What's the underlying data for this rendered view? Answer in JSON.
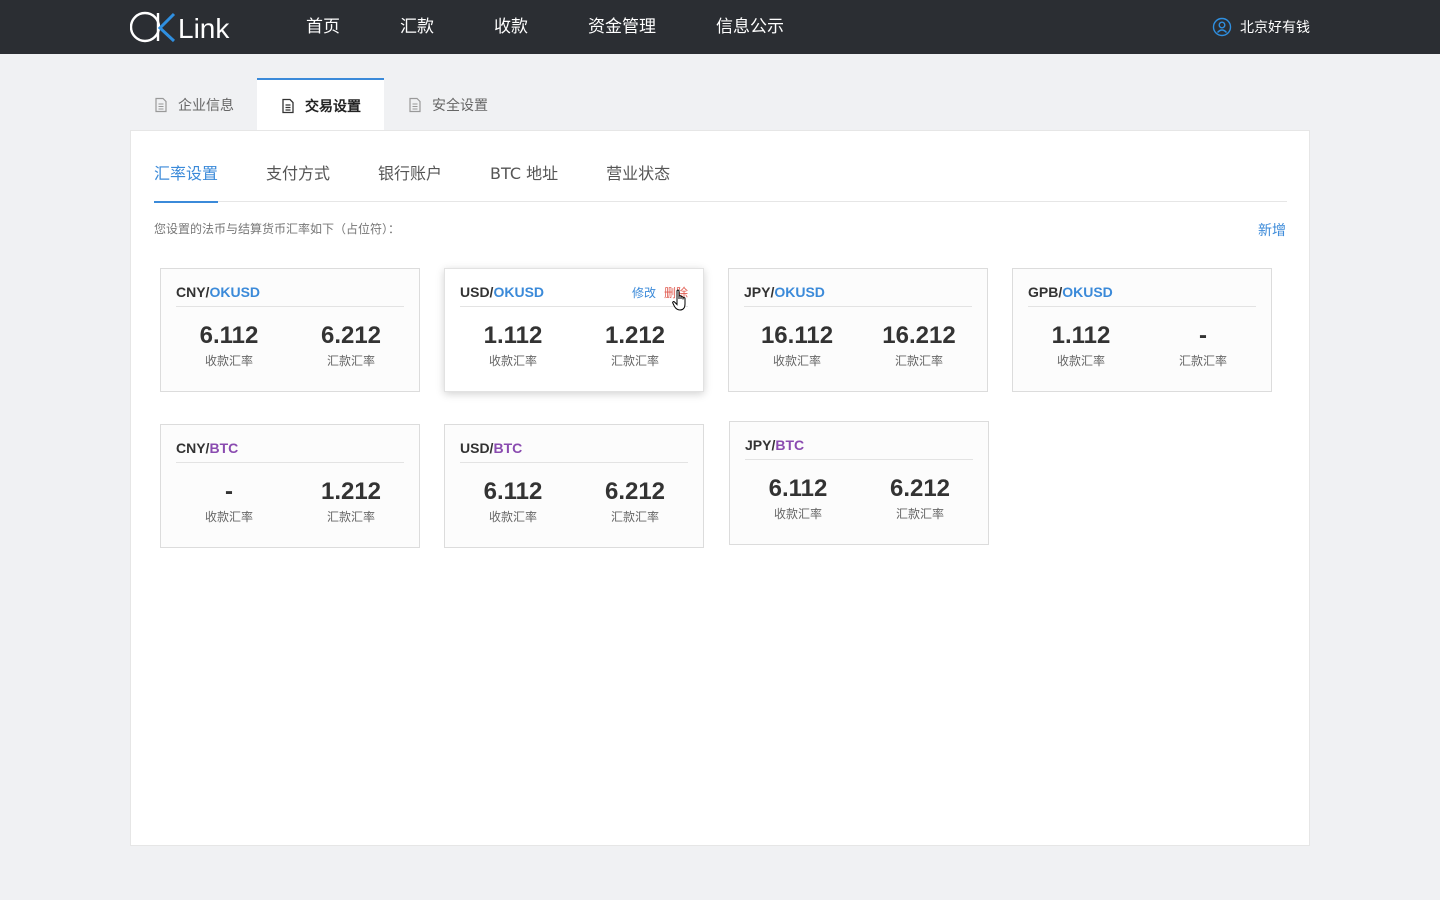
{
  "brand": {
    "logo_text": "OKLink",
    "colors": {
      "topbar": "#2b2e33",
      "accent": "#3b8ad9",
      "danger": "#e05a4f",
      "btc_purple": "#8a4bb0"
    }
  },
  "nav": {
    "items": [
      "首页",
      "汇款",
      "收款",
      "资金管理",
      "信息公示"
    ],
    "user_name": "北京好有钱",
    "user_icon": "user-icon"
  },
  "main_tabs": [
    {
      "label": "企业信息",
      "icon": "document-icon",
      "active": false
    },
    {
      "label": "交易设置",
      "icon": "document-icon",
      "active": true
    },
    {
      "label": "安全设置",
      "icon": "document-icon",
      "active": false
    }
  ],
  "sub_tabs": [
    {
      "label": "汇率设置",
      "active": true
    },
    {
      "label": "支付方式",
      "active": false
    },
    {
      "label": "银行账户",
      "active": false
    },
    {
      "label": "BTC 地址",
      "active": false
    },
    {
      "label": "营业状态",
      "active": false
    }
  ],
  "rates": {
    "description": "您设置的法币与结算货币汇率如下（占位符）：",
    "add_label": "新增",
    "receive_label": "收款汇率",
    "remit_label": "汇款汇率",
    "edit_label": "修改",
    "delete_label": "删除",
    "cards": [
      {
        "base": "CNY/",
        "quote": "OKUSD",
        "receive": "6.112",
        "remit": "6.212"
      },
      {
        "base": "USD/",
        "quote": "OKUSD",
        "receive": "1.112",
        "remit": "1.212"
      },
      {
        "base": "JPY/",
        "quote": "OKUSD",
        "receive": "16.112",
        "remit": "16.212"
      },
      {
        "base": "GPB/",
        "quote": "OKUSD",
        "receive": "1.112",
        "remit": "-"
      },
      {
        "base": "CNY/",
        "quote": "BTC",
        "receive": "-",
        "remit": "1.212"
      },
      {
        "base": "USD/",
        "quote": "BTC",
        "receive": "6.112",
        "remit": "6.212"
      },
      {
        "base": "JPY/",
        "quote": "BTC",
        "receive": "6.112",
        "remit": "6.212"
      }
    ]
  }
}
